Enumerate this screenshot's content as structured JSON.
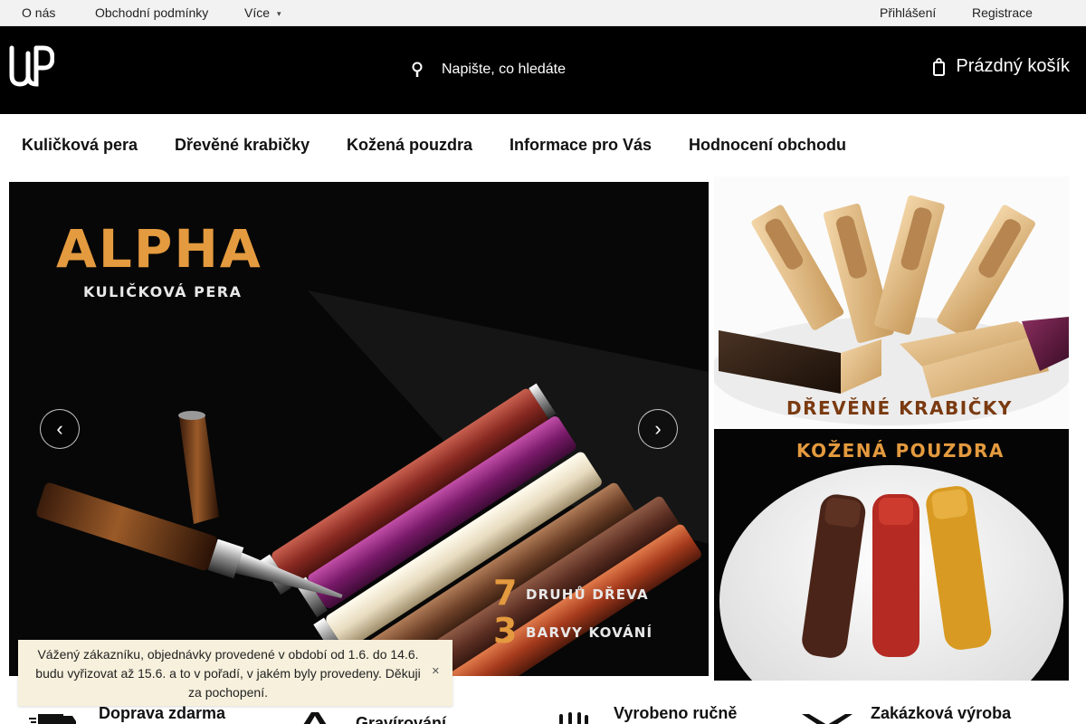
{
  "topbar": {
    "links": [
      {
        "label": "O nás"
      },
      {
        "label": "Obchodní podmínky"
      },
      {
        "label": "Více",
        "caret": "chevron-down-icon"
      }
    ],
    "account": {
      "login_label": "Přihlášení",
      "register_label": "Registrace"
    }
  },
  "header": {
    "logo_icon": "wp-logo",
    "search": {
      "placeholder": "Napište, co hledáte",
      "icon": "search-icon"
    },
    "cart": {
      "label": "Prázdný košík",
      "icon": "cart-icon"
    },
    "colors": {
      "header_bg": "#000000",
      "accent": "#e49a3e"
    }
  },
  "nav": {
    "items": [
      {
        "label": "Kuličková pera"
      },
      {
        "label": "Dřevěné krabičky"
      },
      {
        "label": "Kožená pouzdra"
      },
      {
        "label": "Informace pro Vás"
      },
      {
        "label": "Hodnocení obchodu"
      }
    ]
  },
  "hero": {
    "title": "ALPHA",
    "subtitle": "KULIČKOVÁ PERA",
    "stats": [
      {
        "number": "7",
        "label": "DRUHŮ DŘEVA"
      },
      {
        "number": "3",
        "label": "BARVY KOVÁNÍ"
      }
    ],
    "prev_icon": "chevron-left-icon",
    "next_icon": "chevron-right-icon"
  },
  "banners": {
    "top_caption": "DŘEVĚNÉ  KRABIČKY",
    "bottom_caption": "KOŽENÁ  POUZDRA"
  },
  "notice": {
    "text": "Vážený zákazníku, objednávky provedené v období od 1.6. do 14.6. budu vyřizovat až 15.6. a to v pořadí, v jakém byly provedeny. Děkuji za pochopení.",
    "close_icon": "close-icon"
  },
  "benefits": [
    {
      "title": "Doprava zdarma",
      "icon": "truck-icon"
    },
    {
      "title": "Gravírování",
      "icon": "engraving-icon"
    },
    {
      "title": "Vyrobeno ručně",
      "icon": "hands-icon"
    },
    {
      "title": "Zakázková výroba",
      "icon": "tools-icon"
    }
  ]
}
